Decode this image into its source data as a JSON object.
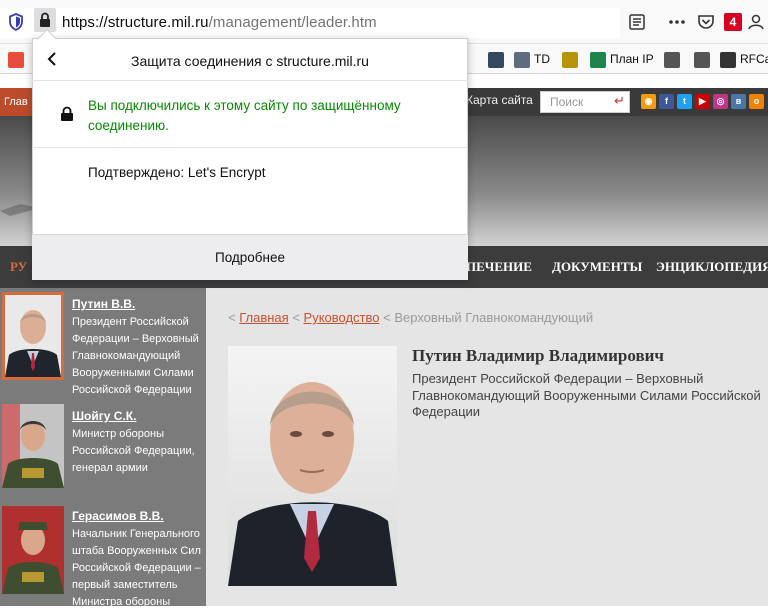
{
  "browser": {
    "url_host": "https://structure.mil.ru",
    "url_path": "/management/leader.htm",
    "badge_count": "4",
    "bookmarks": [
      {
        "label": "",
        "icon": "yandex-icon",
        "color": "#e74c3c"
      },
      {
        "label": "",
        "icon": "r-logo-icon",
        "color": "#34495e"
      },
      {
        "label": "TD",
        "icon": "td-icon",
        "color": "#5d6d7e"
      },
      {
        "label": "",
        "icon": "emblem-icon",
        "color": "#b7950b"
      },
      {
        "label": "План IP",
        "icon": "plus-icon",
        "color": "#1e8449"
      },
      {
        "label": "",
        "icon": "wave-icon",
        "color": "#555555"
      },
      {
        "label": "",
        "icon": "wave-icon",
        "color": "#555555"
      },
      {
        "label": "RFCa",
        "icon": "globe-icon",
        "color": "#333333"
      }
    ]
  },
  "popup": {
    "title": "Защита соединения с structure.mil.ru",
    "secure_message": "Вы подключились к этому сайту по защищённому соединению.",
    "verified_by": "Подтверждено: Let's Encrypt",
    "more_button": "Подробнее"
  },
  "site": {
    "topnav_first": "Глав",
    "sitemap": "Карта сайта",
    "search_placeholder": "Поиск",
    "search_submit_icon": "enter-icon",
    "social": [
      {
        "icon": "rss-icon",
        "color": "#f39c12"
      },
      {
        "icon": "facebook-icon",
        "color": "#3b5998"
      },
      {
        "icon": "twitter-icon",
        "color": "#1da1f2"
      },
      {
        "icon": "youtube-icon",
        "color": "#cc0000"
      },
      {
        "icon": "instagram-icon",
        "color": "#c13584"
      },
      {
        "icon": "vk-icon",
        "color": "#4a76a8"
      },
      {
        "icon": "ok-icon",
        "color": "#ee8208"
      }
    ],
    "nav": {
      "active": "РУ",
      "items": [
        "ПЕЧЕНИЕ",
        "ДОКУМЕНТЫ",
        "ЭНЦИКЛОПЕДИЯ"
      ]
    },
    "sidebar": [
      {
        "name": "Путин В.В.",
        "desc": "Президент Российской Федерации – Верховный Главнокомандующий Вооруженными Силами Российской Федерации"
      },
      {
        "name": "Шойгу С.К.",
        "desc": "Министр обороны Российской Федерации, генерал армии"
      },
      {
        "name": "Герасимов В.В.",
        "desc": "Начальник Генерального штаба Вооруженных Сил Российской Федерации – первый заместитель Министра обороны"
      }
    ],
    "breadcrumb": {
      "home": "Главная",
      "section": "Руководство",
      "current": "Верховный Главнокомандующий"
    },
    "person": {
      "name": "Путин Владимир Владимирович",
      "title": "Президент Российской Федерации – Верховный Главнокомандующий Вооруженными Силами Российской Федерации"
    }
  }
}
